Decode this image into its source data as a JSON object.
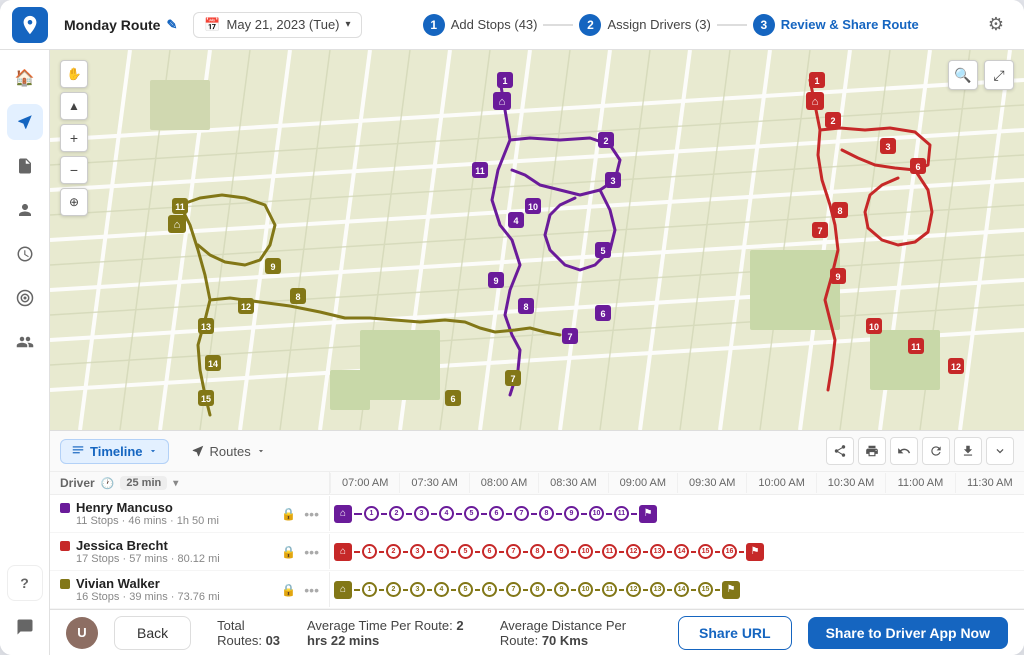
{
  "header": {
    "route_name": "Monday Route",
    "edit_label": "✎",
    "date": "May 21, 2023 (Tue)",
    "gear_icon": "⚙",
    "steps": [
      {
        "num": "1",
        "label": "Add Stops (43)",
        "active": false
      },
      {
        "num": "2",
        "label": "Assign Drivers (3)",
        "active": false
      },
      {
        "num": "3",
        "label": "Review & Share Route",
        "active": true
      }
    ]
  },
  "sidebar": {
    "icons": [
      {
        "name": "home-icon",
        "symbol": "🏠",
        "active": false
      },
      {
        "name": "route-icon",
        "symbol": "↗",
        "active": true
      },
      {
        "name": "stops-icon",
        "symbol": "📋",
        "active": false
      },
      {
        "name": "drivers-icon",
        "symbol": "👤",
        "active": false
      },
      {
        "name": "clock-icon",
        "symbol": "🕐",
        "active": false
      },
      {
        "name": "target-icon",
        "symbol": "◎",
        "active": false
      },
      {
        "name": "contacts-icon",
        "symbol": "👥",
        "active": false
      }
    ],
    "bottom_icons": [
      {
        "name": "help-icon",
        "symbol": "?",
        "active": false
      },
      {
        "name": "chat-icon",
        "symbol": "💬",
        "active": false
      }
    ]
  },
  "map": {
    "zoom_in": "+",
    "zoom_out": "−",
    "locate_icon": "⊕",
    "search_icon": "⌕",
    "fullscreen_icon": "⤢"
  },
  "timeline": {
    "tab_label": "Timeline",
    "routes_label": "Routes",
    "time_interval": "25 min",
    "time_slots": [
      "07:00 AM",
      "07:30 AM",
      "08:00 AM",
      "08:30 AM",
      "09:00 AM",
      "09:30 AM",
      "10:00 AM",
      "10:30 AM",
      "11:00 AM",
      "11:30 AM"
    ],
    "driver_col_label": "Driver",
    "toolbar_icons": [
      "share",
      "print",
      "undo",
      "refresh",
      "download",
      "expand"
    ],
    "drivers": [
      {
        "name": "Henry Mancuso",
        "color": "#6a1b9a",
        "stops": "11 Stops",
        "time": "46 mins",
        "distance": "1h 50 mi",
        "stops_count": 11
      },
      {
        "name": "Jessica Brecht",
        "color": "#c62828",
        "stops": "17 Stops",
        "time": "57 mins",
        "distance": "80.12 mi",
        "stops_count": 17
      },
      {
        "name": "Vivian Walker",
        "color": "#827717",
        "stops": "16 Stops",
        "time": "39 mins",
        "distance": "73.76 mi",
        "stops_count": 16
      }
    ]
  },
  "bottom_bar": {
    "back_label": "Back",
    "total_routes_label": "Total Routes:",
    "total_routes_value": "03",
    "avg_time_label": "Average Time Per Route:",
    "avg_time_value": "2 hrs 22 mins",
    "avg_dist_label": "Average Distance Per Route:",
    "avg_dist_value": "70 Kms",
    "share_url_label": "Share URL",
    "share_driver_label": "Share to Driver App Now"
  }
}
